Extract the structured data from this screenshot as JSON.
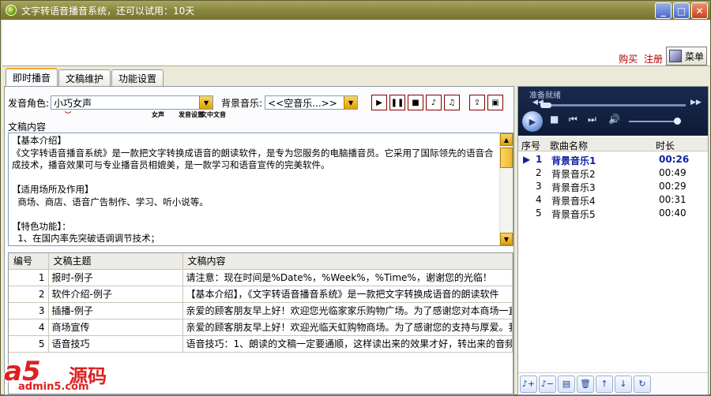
{
  "window": {
    "title": "文字转语音播音系统，还可以试用：10天"
  },
  "topbar": {
    "buy_label": "购买",
    "register_label": "注册",
    "menu_label": "菜单"
  },
  "tabs": [
    {
      "label": "即时播音"
    },
    {
      "label": "文稿维护"
    },
    {
      "label": "功能设置"
    }
  ],
  "controls": {
    "voice_label": "发音角色:",
    "voice_value": "小巧女声",
    "music_label": "背景音乐:",
    "music_value": "<<空音乐...>>",
    "hints": [
      "女声",
      "发音设置",
      "文中文音"
    ]
  },
  "content_label": "文稿内容",
  "content_text": "【基本介绍】\n《文字转语音播音系统》是一款把文字转换成语音的朗读软件，是专为您服务的电脑播音员。它采用了国际领先的语音合成技术，播音效果可与专业播音员相媲美，是一款学习和语音宣传的完美软件。\n\n【适用场所及作用】\n  商场、商店、语音广告制作、学习、听小说等。\n\n【特色功能】：\n  1、在国内率先突破语调调节技术；",
  "table": {
    "headers": [
      "编号",
      "文稿主题",
      "文稿内容"
    ],
    "rows": [
      {
        "id": "1",
        "title": "报时-例子",
        "content": "请注意：现在时间是%Date%，%Week%，%Time%，谢谢您的光临！"
      },
      {
        "id": "2",
        "title": "软件介绍-例子",
        "content": "【基本介绍】，《文字转语音播音系统》是一款把文字转换成语音的朗读软件"
      },
      {
        "id": "3",
        "title": "插播-例子",
        "content": "亲爱的顾客朋友早上好！欢迎您光临家家乐购物广场。为了感谢您对本商场一直"
      },
      {
        "id": "4",
        "title": "商场宣传",
        "content": "亲爱的顾客朋友早上好！欢迎光临天虹购物商场。为了感谢您的支持与厚爱。我"
      },
      {
        "id": "5",
        "title": "语音技巧",
        "content": "语音技巧：1、朗读的文稿一定要通顺，这样读出来的效果才好，转出来的音频"
      }
    ]
  },
  "player": {
    "status": "准备就绪"
  },
  "playlist": {
    "headers": [
      "序号",
      "歌曲名称",
      "时长"
    ],
    "items": [
      {
        "no": "1",
        "name": "背景音乐1",
        "duration": "00:26",
        "active": true
      },
      {
        "no": "2",
        "name": "背景音乐2",
        "duration": "00:49"
      },
      {
        "no": "3",
        "name": "背景音乐3",
        "duration": "00:29"
      },
      {
        "no": "4",
        "name": "背景音乐4",
        "duration": "00:31"
      },
      {
        "no": "5",
        "name": "背景音乐5",
        "duration": "00:40"
      }
    ]
  },
  "watermark": {
    "brand": "a5",
    "text": "源码",
    "url": "admin5.com"
  }
}
